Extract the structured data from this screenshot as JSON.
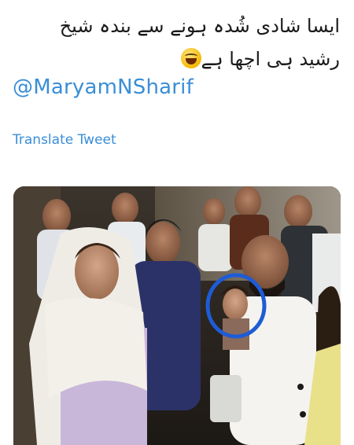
{
  "tweet": {
    "text_line1": "ایسا شادی شُدہ ہونے سے بندہ شیخ",
    "text_line2": "رشید ہی اچھا ہے",
    "emoji": "grinning-sweat-face-emoji",
    "mention": "@MaryamNSharif",
    "translate_label": "Translate Tweet"
  },
  "photo": {
    "description_icon": "group-photo",
    "highlight_color": "#1e5bd6"
  },
  "colors": {
    "link": "#3a8ed6",
    "text": "#1a1a1a",
    "background": "#ffffff"
  }
}
